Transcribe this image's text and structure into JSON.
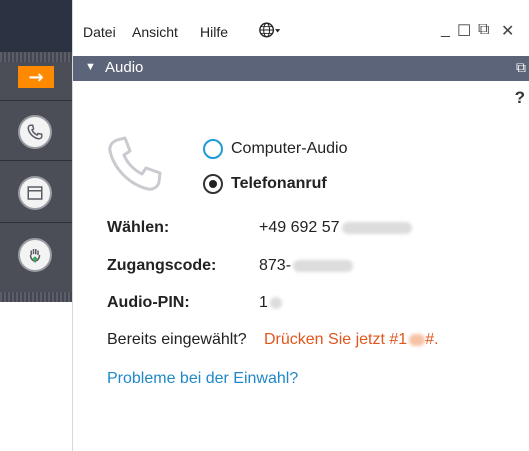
{
  "menu": {
    "items": [
      "Datei",
      "Ansicht",
      "Hilfe"
    ]
  },
  "window_controls": {
    "minimize": "_",
    "maximize": "☐",
    "restore": "⧉",
    "close": "✕"
  },
  "panel": {
    "title": "Audio",
    "help": "?"
  },
  "audio": {
    "option_computer": "Computer-Audio",
    "option_phone": "Telefonanruf",
    "selected": "Telefonanruf",
    "dial_label": "Wählen:",
    "dial_value": "+49 692 57",
    "access_label": "Zugangscode:",
    "access_value": "873-",
    "pin_label": "Audio-PIN:",
    "pin_value": "1",
    "already_label": "Bereits eingewählt?",
    "press_prefix": "Drücken Sie jetzt #1",
    "press_suffix": "#.",
    "problem_link": "Probleme bei der Einwahl?"
  },
  "icons": {
    "rail": [
      "arrow-right-icon",
      "phone-icon",
      "window-icon",
      "raise-hand-icon"
    ],
    "globe": "globe-icon"
  },
  "colors": {
    "accent": "#ff8a00",
    "link": "#1e88c9",
    "highlight": "#e0561e",
    "titlebar": "#5c6479",
    "radio": "#1e9bd7"
  }
}
